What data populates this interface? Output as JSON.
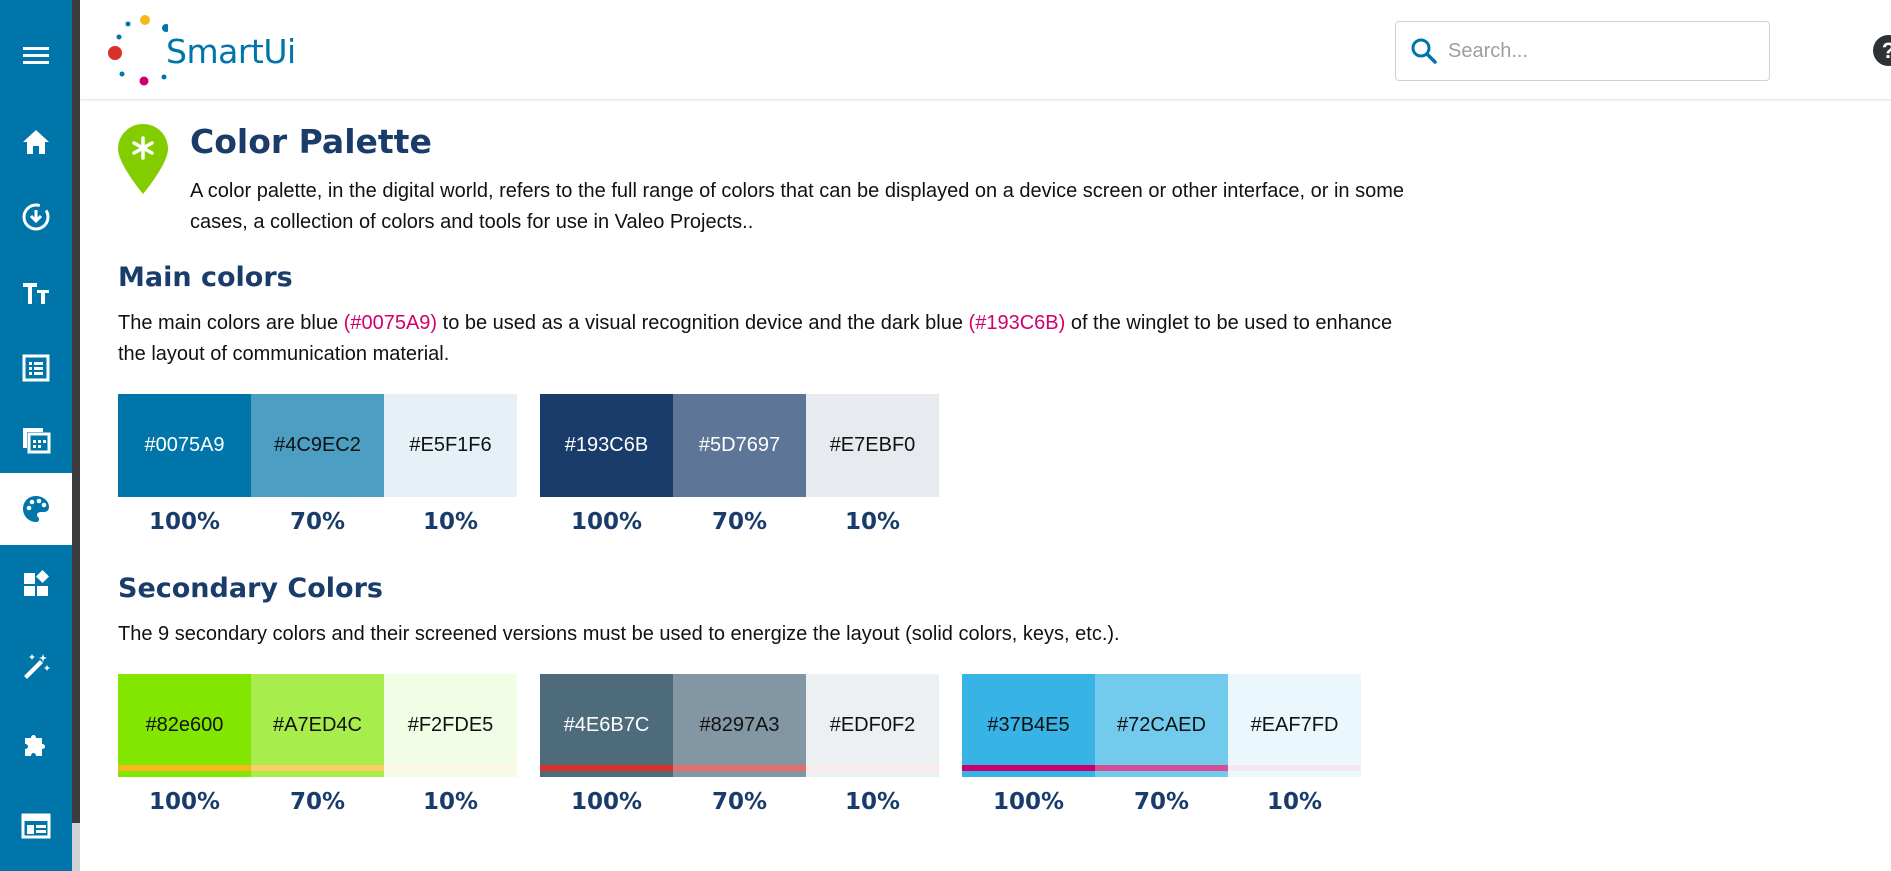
{
  "app": {
    "logo_text": "SmartUi"
  },
  "search": {
    "placeholder": "Search..."
  },
  "help": {
    "label": "?"
  },
  "sidebar": {
    "items": [
      {
        "name": "menu",
        "icon": "hamburger-menu-icon"
      },
      {
        "name": "home",
        "icon": "home-icon"
      },
      {
        "name": "download",
        "icon": "download-circle-icon"
      },
      {
        "name": "typography",
        "icon": "text-size-icon"
      },
      {
        "name": "list",
        "icon": "list-icon"
      },
      {
        "name": "cards",
        "icon": "cards-icon"
      },
      {
        "name": "color-palette",
        "icon": "palette-icon",
        "active": true
      },
      {
        "name": "widgets",
        "icon": "widgets-icon"
      },
      {
        "name": "magic",
        "icon": "magic-wand-icon"
      },
      {
        "name": "plugins",
        "icon": "puzzle-icon"
      },
      {
        "name": "layout",
        "icon": "layout-icon"
      }
    ]
  },
  "page": {
    "title": "Color Palette",
    "intro": "A color palette, in the digital world, refers to the full range of colors that can be displayed on a device screen or other interface, or in some cases, a collection of colors and tools for use in Valeo Projects.."
  },
  "main_colors": {
    "title": "Main colors",
    "desc_1": "The main colors are blue ",
    "desc_hl_1": "(#0075A9)",
    "desc_2": " to be used as a visual recognition device and the dark blue ",
    "desc_hl_2": "(#193C6B)",
    "desc_3": " of the winglet to be used to enhance the layout of communication material.",
    "groups": [
      [
        {
          "hex": "#0075A9",
          "pct": "100%",
          "bg": "#0075A9",
          "fg": "#ffffff"
        },
        {
          "hex": "#4C9EC2",
          "pct": "70%",
          "bg": "#4C9EC2",
          "fg": "#111111"
        },
        {
          "hex": "#E5F1F6",
          "pct": "10%",
          "bg": "#E5F1F6",
          "fg": "#111111"
        }
      ],
      [
        {
          "hex": "#193C6B",
          "pct": "100%",
          "bg": "#193C6B",
          "fg": "#ffffff"
        },
        {
          "hex": "#5D7697",
          "pct": "70%",
          "bg": "#5D7697",
          "fg": "#ffffff"
        },
        {
          "hex": "#E7EBF0",
          "pct": "10%",
          "bg": "#E7EBF0",
          "fg": "#111111"
        }
      ]
    ]
  },
  "secondary_colors": {
    "title": "Secondary Colors",
    "desc": "The 9 secondary colors and their screened versions must be used to energize the layout (solid colors, keys, etc.).",
    "groups": [
      [
        {
          "hex": "#82e600",
          "pct": "100%",
          "bg": "#82e600",
          "fg": "#111111"
        },
        {
          "hex": "#A7ED4C",
          "pct": "70%",
          "bg": "#A7ED4C",
          "fg": "#111111"
        },
        {
          "hex": "#F2FDE5",
          "pct": "10%",
          "bg": "#F2FDE5",
          "fg": "#111111"
        }
      ],
      [
        {
          "hex": "#4E6B7C",
          "pct": "100%",
          "bg": "#4E6B7C",
          "fg": "#ffffff"
        },
        {
          "hex": "#8297A3",
          "pct": "70%",
          "bg": "#8297A3",
          "fg": "#111111"
        },
        {
          "hex": "#EDF0F2",
          "pct": "10%",
          "bg": "#EDF0F2",
          "fg": "#111111"
        }
      ],
      [
        {
          "hex": "#37B4E5",
          "pct": "100%",
          "bg": "#37B4E5",
          "fg": "#111111"
        },
        {
          "hex": "#72CAED",
          "pct": "70%",
          "bg": "#72CAED",
          "fg": "#111111"
        },
        {
          "hex": "#EAF7FD",
          "pct": "10%",
          "bg": "#EAF7FD",
          "fg": "#111111"
        }
      ]
    ],
    "partial_row": [
      [
        "#F9B71E",
        "#FBCD62",
        "#FEF8E8"
      ],
      [
        "#D9302A",
        "#E46F6A",
        "#FBEAEA"
      ],
      [
        "#C8006F",
        "#D84D9A",
        "#F9E5F0"
      ]
    ]
  }
}
